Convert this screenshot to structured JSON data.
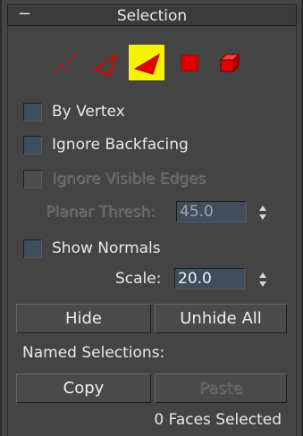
{
  "rollout": {
    "toggle_symbol": "−",
    "title": "Selection"
  },
  "subobject_levels": [
    {
      "name": "vertex",
      "icon": "vertex-icon",
      "active": false
    },
    {
      "name": "edge",
      "icon": "edge-icon",
      "active": false
    },
    {
      "name": "face",
      "icon": "face-icon",
      "active": true
    },
    {
      "name": "polygon",
      "icon": "polygon-icon",
      "active": false
    },
    {
      "name": "element",
      "icon": "element-icon",
      "active": false
    }
  ],
  "options": {
    "by_vertex": "By Vertex",
    "ignore_backfacing": "Ignore Backfacing",
    "ignore_visible_edges": "Ignore Visible Edges"
  },
  "planar_thresh": {
    "label": "Planar Thresh:",
    "value": "45.0"
  },
  "show_normals": "Show Normals",
  "scale": {
    "label": "Scale:",
    "value": "20.0"
  },
  "buttons": {
    "hide": "Hide",
    "unhide_all": "Unhide All",
    "copy": "Copy",
    "paste": "Paste"
  },
  "named_selections_label": "Named Selections:",
  "status": "0 Faces Selected",
  "colors": {
    "accent_yellow": "#f6f200",
    "icon_red": "#e00000",
    "spinner_field": "#3f4d5c"
  }
}
